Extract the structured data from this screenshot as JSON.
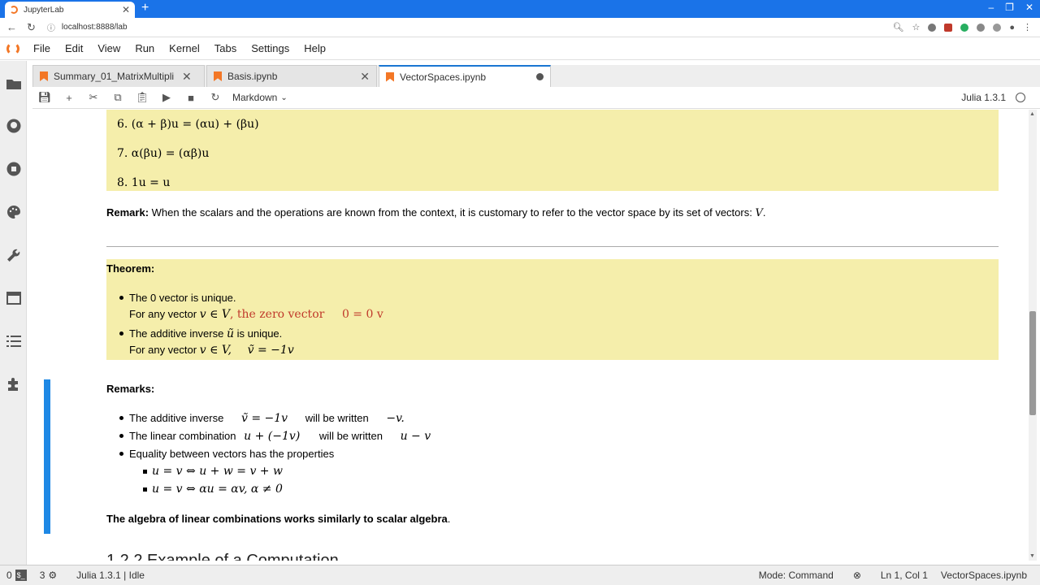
{
  "browser": {
    "tab_title": "JupyterLab",
    "url": "localhost:8888/lab"
  },
  "menu": [
    "File",
    "Edit",
    "View",
    "Run",
    "Kernel",
    "Tabs",
    "Settings",
    "Help"
  ],
  "doc_tabs": [
    {
      "label": "Summary_01_MatrixMultipli"
    },
    {
      "label": "Basis.ipynb"
    },
    {
      "label": "VectorSpaces.ipynb"
    }
  ],
  "toolbar": {
    "cell_type": "Markdown",
    "kernel_name": "Julia 1.3.1"
  },
  "notebook": {
    "axiom6": "6. (α + β)u = (αu) + (βu)",
    "axiom7": "7. α(βu) = (αβ)u",
    "axiom8": "8. 1u = u",
    "remark_label": "Remark:",
    "remark_text": "When the scalars and the operations are known from the context, it is customary to refer to the vector space by its set of vectors:",
    "remark_var": "V",
    "theorem_label": "Theorem:",
    "t1_line1": "The 0 vector is unique.",
    "t1_line2_prefix": "For any vector",
    "t1_line2_math": "v ∈ V",
    "t1_line2_red": ", the zero vector",
    "t1_line2_eq": "0 = 0 v",
    "t2_line1_a": "The additive inverse",
    "t2_line1_math": "ũ",
    "t2_line1_b": "is unique.",
    "t2_line2_prefix": "For any vector",
    "t2_line2_math": "v ∈ V,",
    "t2_line2_eq": "ṽ = −1v",
    "remarks_label": "Remarks:",
    "r1_a": "The additive inverse",
    "r1_math": "ṽ = −1v",
    "r1_b": "will be written",
    "r1_math2": "−v.",
    "r2_a": "The linear combination",
    "r2_math": "u + (−1v)",
    "r2_b": "will be written",
    "r2_math2": "u − v",
    "r3": "Equality between vectors has the properties",
    "r3_sub1": "u = v ⇔ u + w = v + w",
    "r3_sub2": "u = v ⇔ αu = αv, α ≠ 0",
    "algebra_bold": "The algebra of linear combinations works similarly to scalar algebra",
    "algebra_dot": ".",
    "next_heading": "1.2.2 Example of a Computation"
  },
  "status": {
    "left_count_a": "0",
    "left_count_b": "3",
    "kernel_status": "Julia 1.3.1 | Idle",
    "mode": "Mode: Command",
    "cursor": "Ln 1, Col 1",
    "filename": "VectorSpaces.ipynb"
  }
}
